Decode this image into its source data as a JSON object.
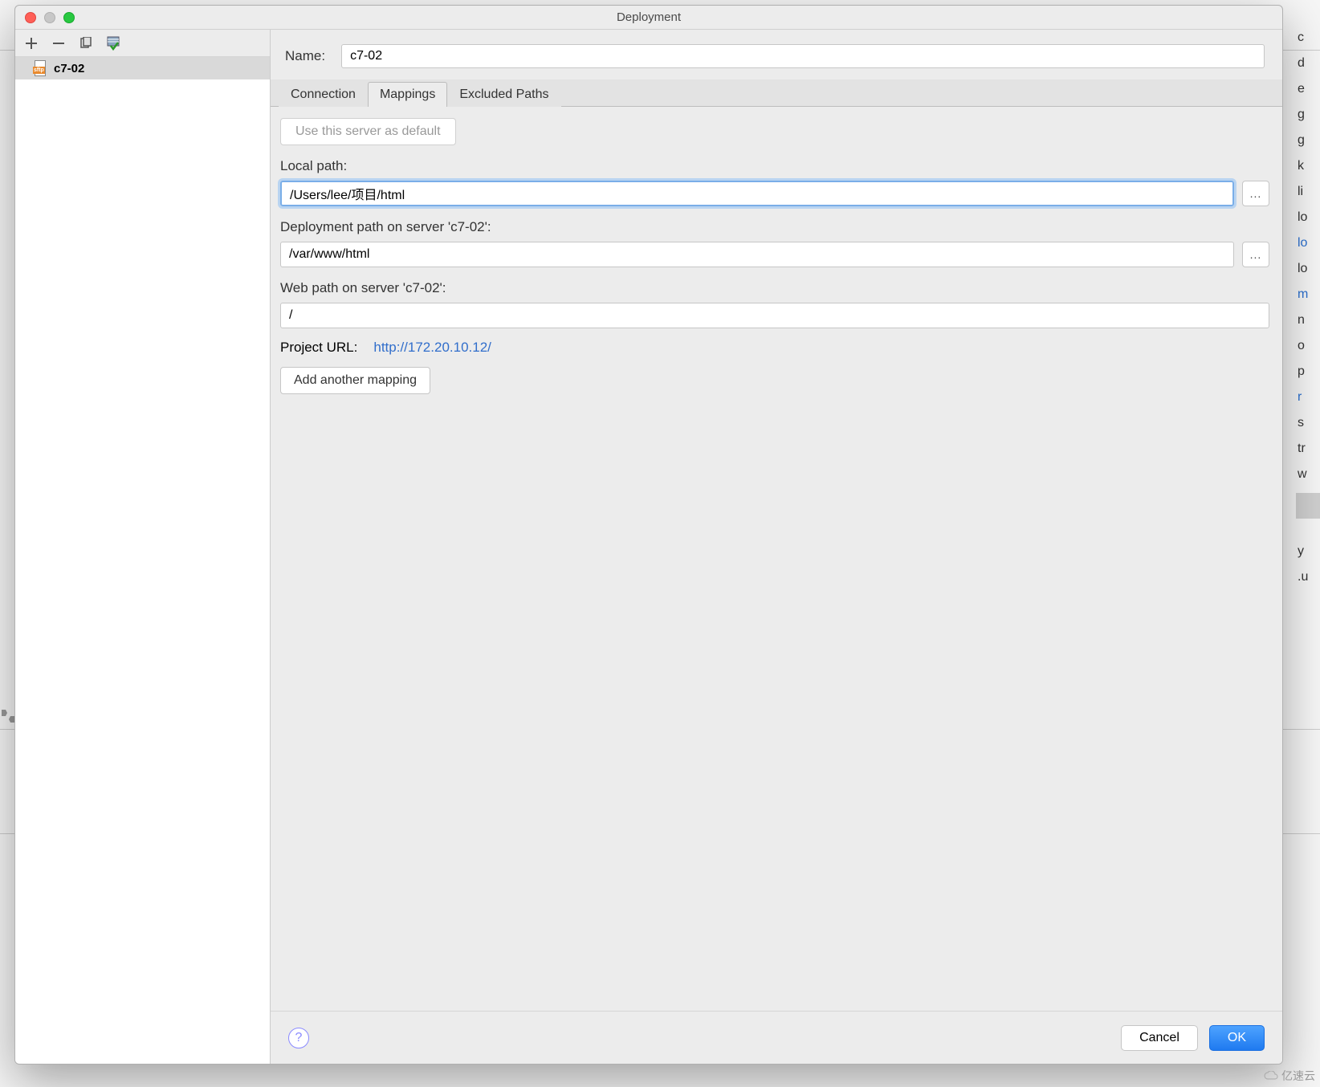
{
  "bg_items": [
    "c",
    "d",
    "e",
    "g",
    "g",
    "k",
    "li",
    "lo",
    "lo",
    "lo",
    "m",
    "n",
    "o",
    "p",
    "r",
    "s",
    "tr",
    "w",
    "",
    "",
    "y",
    ".u"
  ],
  "bg_blue_idx": [
    8,
    10,
    14
  ],
  "bg_highlight_idx": 18,
  "dialog": {
    "title": "Deployment",
    "name_label": "Name:",
    "name_value": "c7-02",
    "tabs": {
      "connection": "Connection",
      "mappings": "Mappings",
      "excluded": "Excluded Paths"
    },
    "default_button": "Use this server as default",
    "local_path_label": "Local path:",
    "local_path_value": "/Users/lee/项目/html",
    "deploy_path_label": "Deployment path on server 'c7-02':",
    "deploy_path_value": "/var/www/html",
    "web_path_label": "Web path on server 'c7-02':",
    "web_path_value": "/",
    "project_url_label": "Project URL:",
    "project_url_value": "http://172.20.10.12/",
    "add_mapping": "Add another mapping",
    "browse_label": "...",
    "cancel": "Cancel",
    "ok": "OK",
    "help_label": "?"
  },
  "sidebar": {
    "item_label": "c7-02",
    "sftp_tag": "sftp"
  },
  "watermark": "亿速云"
}
